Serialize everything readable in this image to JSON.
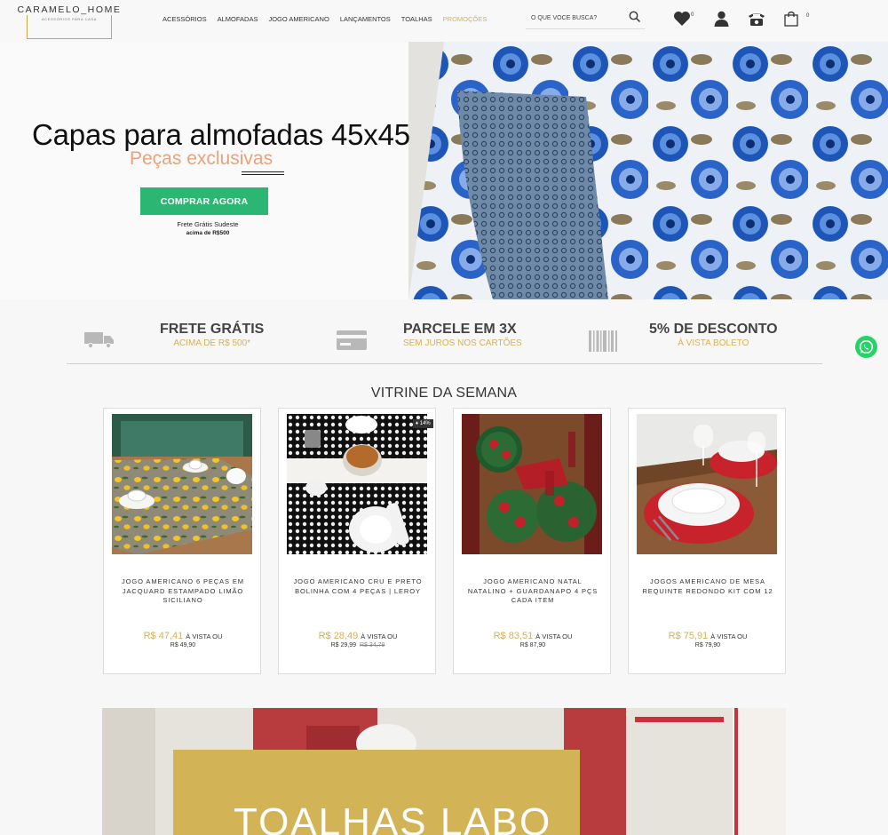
{
  "header": {
    "logo": {
      "name": "CARAMELO_HOME",
      "tagline": "ACESSÓRIOS PARA CASA"
    },
    "nav": [
      {
        "label": "ACESSÓRIOS"
      },
      {
        "label": "ALMOFADAS"
      },
      {
        "label": "JOGO AMERICANO"
      },
      {
        "label": "LANÇAMENTOS"
      },
      {
        "label": "TOALHAS"
      },
      {
        "label": "PROMOÇÕES",
        "highlight": true
      }
    ],
    "search": {
      "placeholder": "O QUE VOCÊ BUSCA?",
      "icon": "search-icon"
    },
    "wishlist_count": "0",
    "cart_count": "0"
  },
  "hero": {
    "title": "Capas para almofadas 45x45",
    "subtitle": "Peças exclusivas",
    "cta": "COMPRAR AGORA",
    "note_line1": "Frete Grátis Sudeste",
    "note_line2": "acima de R$500"
  },
  "benefits": [
    {
      "title": "FRETE GRÁTIS",
      "subtitle": "ACIMA DE R$ 500*",
      "icon": "truck-icon"
    },
    {
      "title": "PARCELE EM 3X",
      "subtitle": "SEM JUROS NOS CARTÕES",
      "icon": "credit-card-icon"
    },
    {
      "title": "5% DE DESCONTO",
      "subtitle": "À VISTA BOLETO",
      "icon": "barcode-icon"
    }
  ],
  "vitrine": {
    "title": "VITRINE DA SEMANA",
    "products": [
      {
        "name": "JOGO AMERICANO 6 PEÇAS EM JACQUARD ESTAMPADO LIMÃO SICILIANO",
        "price": "R$ 47,41",
        "price_suffix": "À VISTA OU",
        "installment": "R$ 49,90",
        "old_price": ""
      },
      {
        "name": "JOGO AMERICANO CRU E PRETO BOLINHA COM 4 PEÇAS | LEROY",
        "price": "R$ 28,49",
        "price_suffix": "À VISTA OU",
        "installment": "R$ 29,99",
        "old_price": "R$ 34,79",
        "badge": "♦ 14%"
      },
      {
        "name": "JOGO AMERICANO NATAL NATALINO + GUARDANAPO 4 PÇS CADA ITEM",
        "price": "R$ 83,51",
        "price_suffix": "À VISTA OU",
        "installment": "R$ 87,90",
        "old_price": ""
      },
      {
        "name": "JOGOS AMERICANO DE MESA REQUINTE REDONDO KIT COM 12",
        "price": "R$ 75,91",
        "price_suffix": "À VISTA OU",
        "installment": "R$ 79,90",
        "old_price": ""
      }
    ]
  },
  "banner2": {
    "text": "TOALHAS LABO"
  },
  "colors": {
    "gold": "#d4b25a",
    "green": "#2bb673",
    "peach": "#e8a27b",
    "whatsapp": "#25d366"
  }
}
